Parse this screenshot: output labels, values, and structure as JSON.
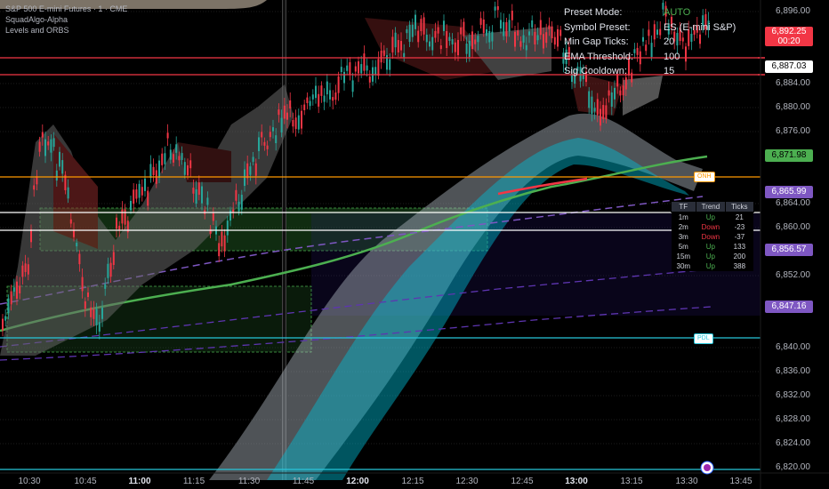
{
  "header": {
    "symbol_line": "S&P 500 E-mini Futures · 1 · CME",
    "indicator1": "SquadAlgo-Alpha",
    "indicator2": "Levels and ORBS"
  },
  "settings": [
    {
      "key": "Preset Mode:",
      "value": "AUTO",
      "color": "#4caf50"
    },
    {
      "key": "Symbol Preset:",
      "value": "ES (E-mini S&P)"
    },
    {
      "key": "Min Gap Ticks:",
      "value": "20"
    },
    {
      "key": "EMA Threshold:",
      "value": "100"
    },
    {
      "key": "Sig Cooldown:",
      "value": "15"
    }
  ],
  "price_axis": {
    "labels": [
      "6,896.00",
      "6,884.00",
      "6,880.00",
      "6,876.00",
      "6,864.00",
      "6,860.00",
      "6,852.00",
      "6,840.00",
      "6,836.00",
      "6,832.00",
      "6,828.00",
      "6,824.00",
      "6,820.00"
    ],
    "current": {
      "price": "6,892.25",
      "countdown": "00:20",
      "color": "#f23645"
    },
    "tags": [
      {
        "text": "6,887.03",
        "bg": "#ffffff",
        "fg": "#000000"
      },
      {
        "text": "6,871.98",
        "bg": "#4caf50",
        "fg": "#000000"
      },
      {
        "text": "6,865.99",
        "bg": "#7e57c2",
        "fg": "#ffffff"
      },
      {
        "text": "6,856.57",
        "bg": "#7e57c2",
        "fg": "#ffffff"
      },
      {
        "text": "6,847.16",
        "bg": "#7e57c2",
        "fg": "#ffffff"
      }
    ]
  },
  "time_axis": [
    {
      "t": "10:30",
      "bold": false
    },
    {
      "t": "10:45",
      "bold": false
    },
    {
      "t": "11:00",
      "bold": true
    },
    {
      "t": "11:15",
      "bold": false
    },
    {
      "t": "11:30",
      "bold": false
    },
    {
      "t": "11:45",
      "bold": false
    },
    {
      "t": "12:00",
      "bold": true
    },
    {
      "t": "12:15",
      "bold": false
    },
    {
      "t": "12:30",
      "bold": false
    },
    {
      "t": "12:45",
      "bold": false
    },
    {
      "t": "13:00",
      "bold": true
    },
    {
      "t": "13:15",
      "bold": false
    },
    {
      "t": "13:30",
      "bold": false
    },
    {
      "t": "13:45",
      "bold": false
    }
  ],
  "level_tags": {
    "onh": "ONH",
    "pdl": "PDL"
  },
  "trend_table": {
    "headers": [
      "TF",
      "Trend",
      "Ticks"
    ],
    "rows": [
      {
        "tf": "1m",
        "trend": "Up",
        "ticks": "21"
      },
      {
        "tf": "2m",
        "trend": "Down",
        "ticks": "-23"
      },
      {
        "tf": "3m",
        "trend": "Down",
        "ticks": "-37"
      },
      {
        "tf": "5m",
        "trend": "Up",
        "ticks": "133"
      },
      {
        "tf": "15m",
        "trend": "Up",
        "ticks": "200"
      },
      {
        "tf": "30m",
        "trend": "Up",
        "ticks": "388"
      }
    ]
  }
}
